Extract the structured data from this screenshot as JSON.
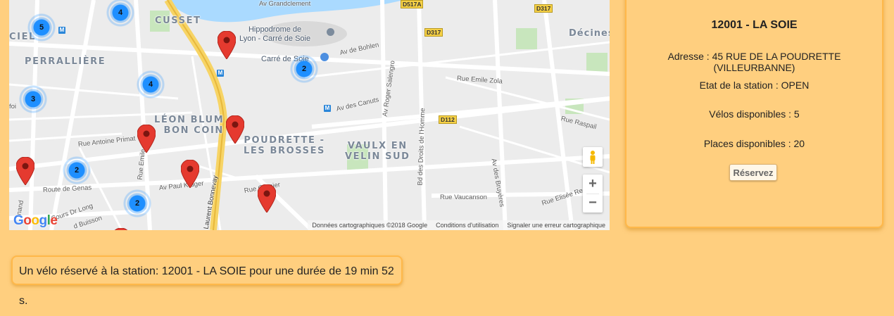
{
  "map": {
    "area_labels": {
      "cusset": "CUSSET",
      "perralliere": "PERRALLIÈRE",
      "leon_blum": "LÉON BLUM -\nBON COIN",
      "poudrette": "POUDRETTE -\nLES BROSSES",
      "vaulx": "VAULX EN\nVELIN SUD",
      "decines": "Décines",
      "ciel": "CIEL"
    },
    "poi_labels": {
      "hippodrome": "Hippodrome de\nLyon - Carré de Soie",
      "carre_de_soie": "Carré de Soie"
    },
    "streets": {
      "av_grandclement": "Av Grandclement",
      "av_bohlen": "Av de Bohlen",
      "av_roger_salengro": "Av Roger Salengro",
      "rue_emile_zola": "Rue Emile Zola",
      "av_canuts": "Av des Canuts",
      "bd_droits_homme": "Bd des Droits de l'Homme",
      "rue_raspail": "Rue Raspail",
      "rue_antoine_primat": "Rue Antoine Primat",
      "rue_emile": "Rue Emile",
      "route_genas": "Route de Genas",
      "av_paul_kruger": "Av Paul Kruger",
      "laurent_bonnevay": "Laurent Bonnevay",
      "rue_garnier": "Rue     Garnier",
      "av_bruyeres": "Av des Bruyères",
      "rue_vaucanson": "Rue Vaucanson",
      "rue_elisee_reclus": "Rue Elisée Reclus",
      "cours_dr_long": "Cours Dr Long",
      "d_buisson": "d Buisson",
      "nand": "nand",
      "foi": "foi"
    },
    "routes": [
      "D517A",
      "D317",
      "D317",
      "D112"
    ],
    "clusters": [
      "4",
      "5",
      "2",
      "4",
      "3",
      "2",
      "2"
    ],
    "attribution": {
      "data": "Données cartographiques ©2018 Google",
      "terms": "Conditions d'utilisation",
      "report": "Signaler une erreur cartographique"
    },
    "logo": "Google",
    "zoom_in": "+",
    "zoom_out": "−",
    "metro_symbol": "M",
    "pegman_icon": "pegman-icon"
  },
  "station": {
    "title": "12001 - LA SOIE",
    "address": "Adresse : 45 RUE DE LA POUDRETTE (VILLEURBANNE)",
    "state": "Etat de la station : OPEN",
    "bikes": "Vélos disponibles : 5",
    "places": "Places disponibles : 20",
    "reserve_label": "Réservez"
  },
  "notice": {
    "text": "Un vélo réservé à la station: 12001 - LA SOIE pour une durée de 19 min 52 s."
  },
  "colors": {
    "page_bg": "#ffcf7f",
    "panel_border": "#ffb84a",
    "cluster": "#1e8fff",
    "marker": "#e53a2f"
  }
}
